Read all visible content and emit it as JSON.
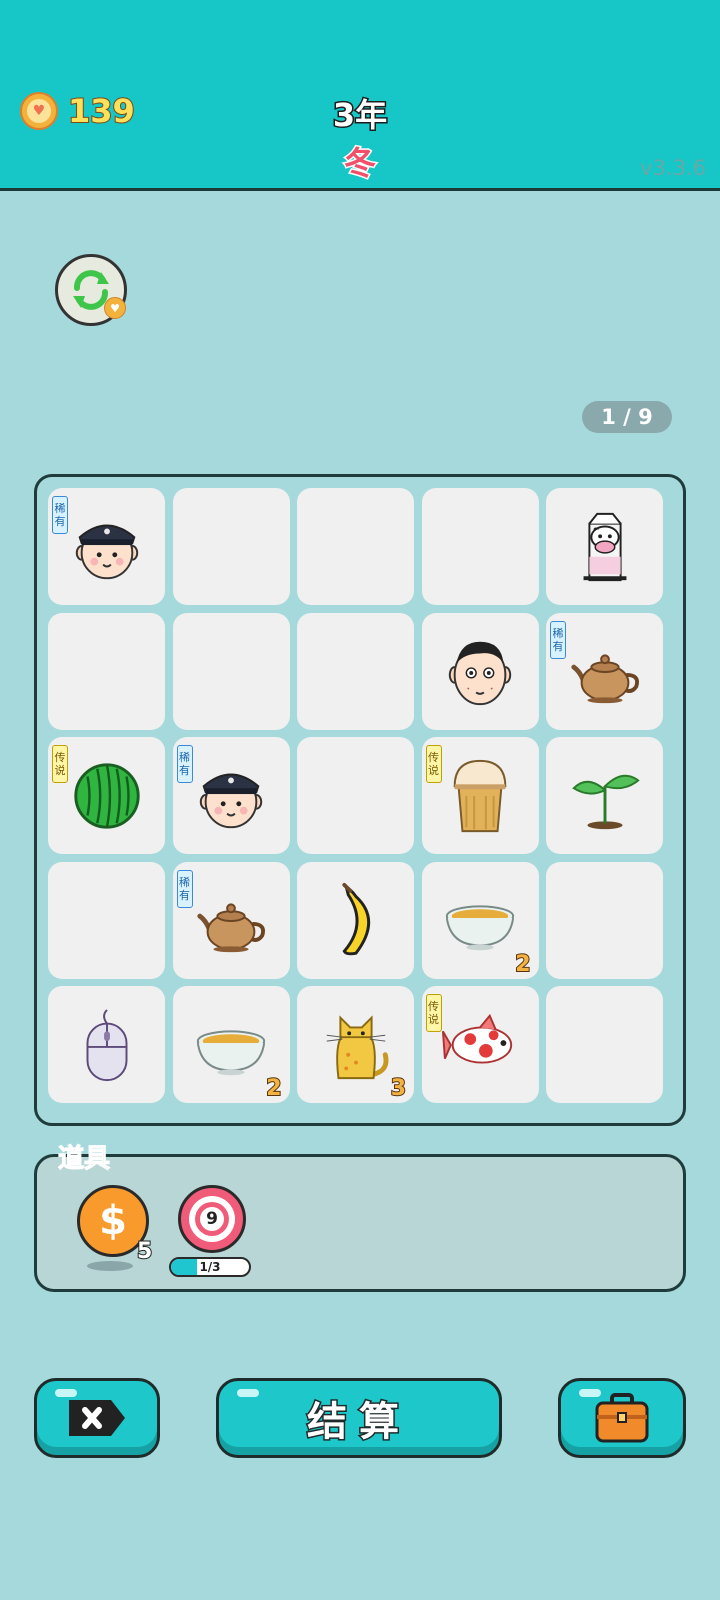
{
  "header": {
    "coins": "139",
    "year": "3年",
    "season": "冬",
    "version": "v3.3.6"
  },
  "page_indicator": "1 / 9",
  "board": {
    "cells": [
      {
        "icon": "police-officer-icon",
        "tag": "稀有"
      },
      {
        "icon": ""
      },
      {
        "icon": ""
      },
      {
        "icon": ""
      },
      {
        "icon": "milk-carton-icon"
      },
      {
        "icon": ""
      },
      {
        "icon": ""
      },
      {
        "icon": ""
      },
      {
        "icon": "man-face-icon"
      },
      {
        "icon": "teapot-icon",
        "tag": "稀有"
      },
      {
        "icon": "watermelon-icon",
        "tag": "传说"
      },
      {
        "icon": "police-officer-icon",
        "tag": "稀有"
      },
      {
        "icon": ""
      },
      {
        "icon": "bubble-tea-icon",
        "tag": "传说"
      },
      {
        "icon": "sprout-icon"
      },
      {
        "icon": ""
      },
      {
        "icon": "teapot-icon",
        "tag": "稀有"
      },
      {
        "icon": "banana-icon"
      },
      {
        "icon": "soup-bowl-icon",
        "count": "2"
      },
      {
        "icon": ""
      },
      {
        "icon": "computer-mouse-icon"
      },
      {
        "icon": "soup-bowl-icon",
        "count": "2"
      },
      {
        "icon": "yellow-cat-icon",
        "count": "3"
      },
      {
        "icon": "koi-fish-icon",
        "tag": "传说"
      },
      {
        "icon": ""
      }
    ]
  },
  "props": {
    "title": "道具",
    "coin_prop": {
      "symbol": "$",
      "count": "5"
    },
    "target_prop": {
      "value": "9",
      "progress_text": "1/3",
      "progress": 0.333
    }
  },
  "buttons": {
    "settle": "结算"
  }
}
